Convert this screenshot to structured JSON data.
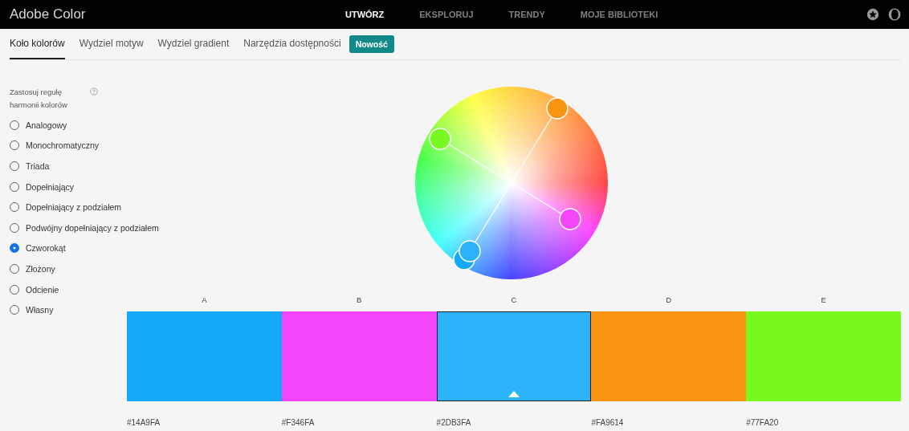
{
  "header": {
    "logo": "Adobe Color",
    "nav": [
      {
        "label": "UTWÓRZ",
        "selected": true
      },
      {
        "label": "EKSPLORUJ",
        "selected": false
      },
      {
        "label": "TRENDY",
        "selected": false
      },
      {
        "label": "MOJE BIBLIOTEKI",
        "selected": false
      }
    ]
  },
  "tabs": [
    {
      "label": "Koło kolorów",
      "selected": true
    },
    {
      "label": "Wydziel motyw",
      "selected": false
    },
    {
      "label": "Wydziel gradient",
      "selected": false
    },
    {
      "label": "Narzędzia dostępności",
      "selected": false
    }
  ],
  "new_badge": "Nowość",
  "harmony": {
    "title": "Zastosuj regułę harmonii kolorów",
    "options": [
      {
        "label": "Analogowy",
        "selected": false
      },
      {
        "label": "Monochromatyczny",
        "selected": false
      },
      {
        "label": "Triada",
        "selected": false
      },
      {
        "label": "Dopełniający",
        "selected": false
      },
      {
        "label": "Dopełniający z podziałem",
        "selected": false
      },
      {
        "label": "Podwójny dopełniający z podziałem",
        "selected": false
      },
      {
        "label": "Czworokąt",
        "selected": true
      },
      {
        "label": "Złożony",
        "selected": false
      },
      {
        "label": "Odcienie",
        "selected": false
      },
      {
        "label": "Własny",
        "selected": false
      }
    ]
  },
  "swatches": [
    {
      "label": "A",
      "color": "#14a9fa",
      "hex": "#14A9FA",
      "selected": false
    },
    {
      "label": "B",
      "color": "#f346fa",
      "hex": "#F346FA",
      "selected": false
    },
    {
      "label": "C",
      "color": "#2db3fa",
      "hex": "#2DB3FA",
      "selected": true
    },
    {
      "label": "D",
      "color": "#fa9614",
      "hex": "#FA9614",
      "selected": false
    },
    {
      "label": "E",
      "color": "#77fa20",
      "hex": "#77FA20",
      "selected": false
    }
  ]
}
